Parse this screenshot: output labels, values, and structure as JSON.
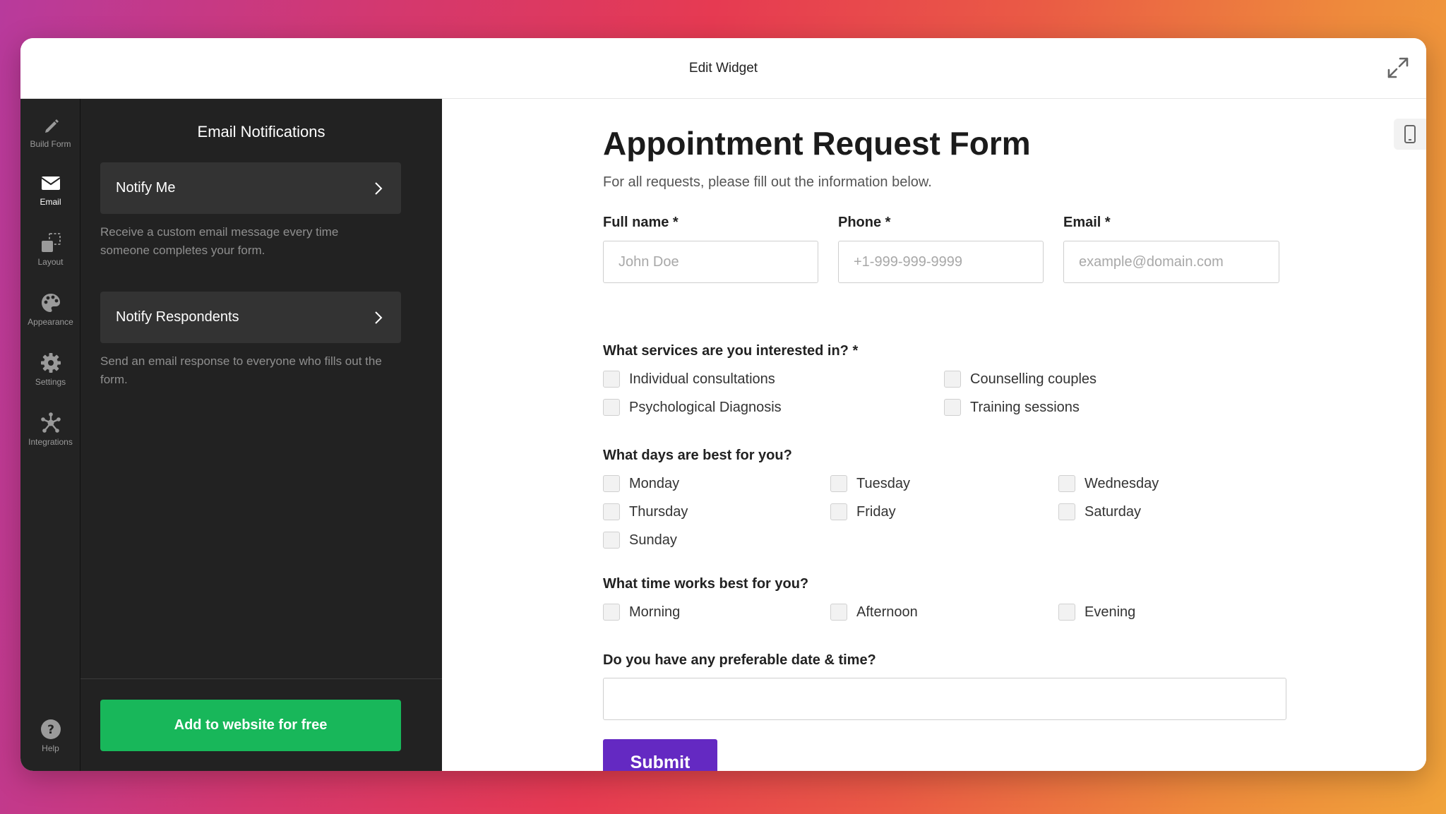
{
  "window": {
    "title": "Edit Widget"
  },
  "sidebar": {
    "items": [
      {
        "label": "Build Form",
        "icon": "pencil-icon"
      },
      {
        "label": "Email",
        "icon": "envelope-icon"
      },
      {
        "label": "Layout",
        "icon": "layout-icon"
      },
      {
        "label": "Appearance",
        "icon": "palette-icon"
      },
      {
        "label": "Settings",
        "icon": "gear-icon"
      },
      {
        "label": "Integrations",
        "icon": "integrations-icon"
      },
      {
        "label": "Help",
        "icon": "help-icon"
      }
    ],
    "active": "Email"
  },
  "panel": {
    "title": "Email Notifications",
    "cards": [
      {
        "label": "Notify Me",
        "description": "Receive a custom email message every time someone completes your form."
      },
      {
        "label": "Notify Respondents",
        "description": "Send an email response to everyone who fills out the form."
      }
    ],
    "add_button": "Add to website for free"
  },
  "form": {
    "title": "Appointment Request Form",
    "subtitle": "For all requests, please fill out the information below.",
    "fields": {
      "full_name": {
        "label": "Full name *",
        "placeholder": "John Doe"
      },
      "phone": {
        "label": "Phone *",
        "placeholder": "+1-999-999-9999"
      },
      "email": {
        "label": "Email *",
        "placeholder": "example@domain.com"
      }
    },
    "services": {
      "question": "What services are you interested in? *",
      "options": [
        "Individual consultations",
        "Counselling couples",
        "Psychological Diagnosis",
        "Training sessions"
      ]
    },
    "days": {
      "question": "What days are best for you?",
      "options": [
        "Monday",
        "Tuesday",
        "Wednesday",
        "Thursday",
        "Friday",
        "Saturday",
        "Sunday"
      ]
    },
    "times": {
      "question": "What time works best for you?",
      "options": [
        "Morning",
        "Afternoon",
        "Evening"
      ]
    },
    "datetime": {
      "question": "Do you have any preferable date & time?",
      "value": ""
    },
    "submit_label": "Submit"
  },
  "colors": {
    "accent": "#6429c2",
    "cta": "#18b75a",
    "panel_bg": "#222222",
    "card_bg": "#333333"
  }
}
